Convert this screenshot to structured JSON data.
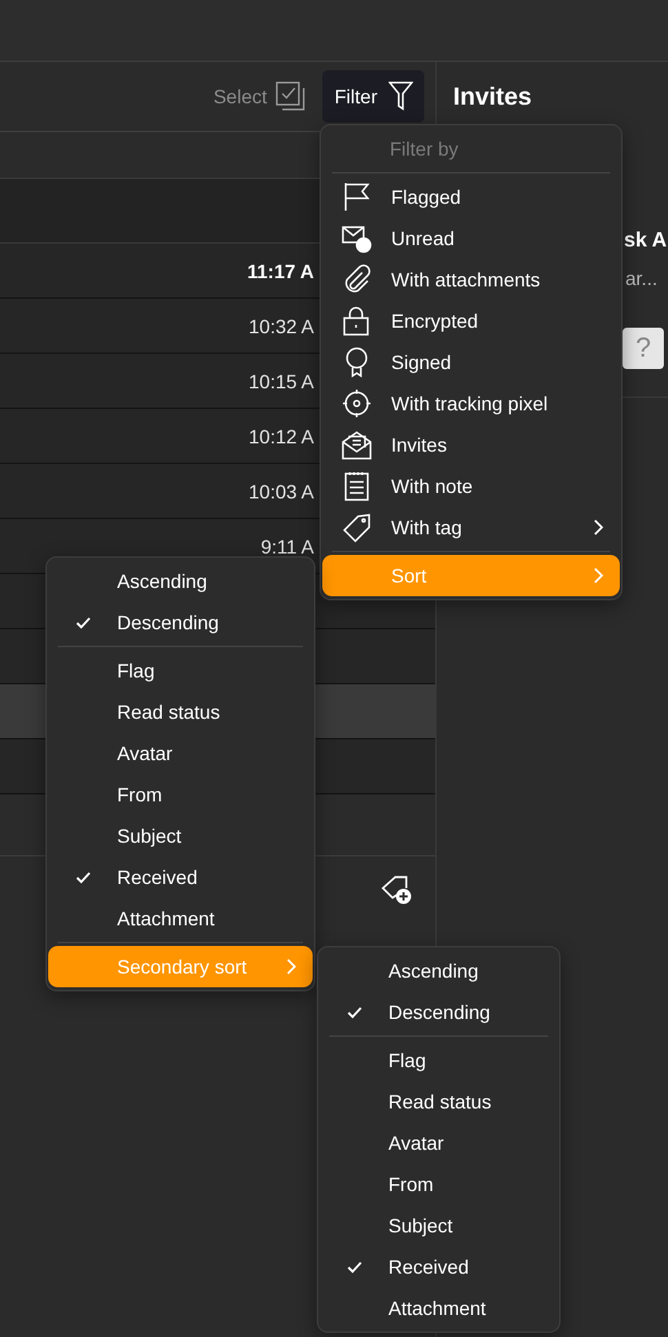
{
  "toolbar": {
    "select_label": "Select",
    "filter_button": "Filter"
  },
  "messages": [
    {
      "time": "11:17 A",
      "unread": true
    },
    {
      "time": "10:32 A",
      "unread": false
    },
    {
      "time": "10:15 A",
      "unread": false
    },
    {
      "time": "10:12 A",
      "unread": false
    },
    {
      "time": "10:03 A",
      "unread": false
    },
    {
      "time": "9:11 A",
      "unread": false
    }
  ],
  "hidden_rows": [
    {
      "selected": false
    },
    {
      "selected": false
    },
    {
      "selected": true
    },
    {
      "selected": false
    }
  ],
  "right_panel": {
    "title": "Invites",
    "preview_title": "sk A",
    "preview_text": "ar...",
    "help_button": "?"
  },
  "filter_menu": {
    "header": "Filter by",
    "items": [
      {
        "label": "Flagged",
        "submenu": false,
        "selected": false
      },
      {
        "label": "Unread",
        "submenu": false,
        "selected": false
      },
      {
        "label": "With attachments",
        "submenu": false,
        "selected": false
      },
      {
        "label": "Encrypted",
        "submenu": false,
        "selected": false
      },
      {
        "label": "Signed",
        "submenu": false,
        "selected": false
      },
      {
        "label": "With tracking pixel",
        "submenu": false,
        "selected": false
      },
      {
        "label": "Invites",
        "submenu": false,
        "selected": false
      },
      {
        "label": "With note",
        "submenu": false,
        "selected": false
      },
      {
        "label": "With tag",
        "submenu": true,
        "selected": false
      }
    ],
    "sort": {
      "label": "Sort",
      "submenu": true,
      "selected": true
    }
  },
  "sort_menu": {
    "order": [
      {
        "label": "Ascending",
        "checked": false
      },
      {
        "label": "Descending",
        "checked": true
      }
    ],
    "fields": [
      {
        "label": "Flag",
        "checked": false
      },
      {
        "label": "Read status",
        "checked": false
      },
      {
        "label": "Avatar",
        "checked": false
      },
      {
        "label": "From",
        "checked": false
      },
      {
        "label": "Subject",
        "checked": false
      },
      {
        "label": "Received",
        "checked": true
      },
      {
        "label": "Attachment",
        "checked": false
      }
    ],
    "secondary": {
      "label": "Secondary sort",
      "submenu": true,
      "selected": true
    }
  },
  "secondary_sort_menu": {
    "order": [
      {
        "label": "Ascending",
        "checked": false
      },
      {
        "label": "Descending",
        "checked": true
      }
    ],
    "fields": [
      {
        "label": "Flag",
        "checked": false
      },
      {
        "label": "Read status",
        "checked": false
      },
      {
        "label": "Avatar",
        "checked": false
      },
      {
        "label": "From",
        "checked": false
      },
      {
        "label": "Subject",
        "checked": false
      },
      {
        "label": "Received",
        "checked": true
      },
      {
        "label": "Attachment",
        "checked": false
      }
    ]
  }
}
